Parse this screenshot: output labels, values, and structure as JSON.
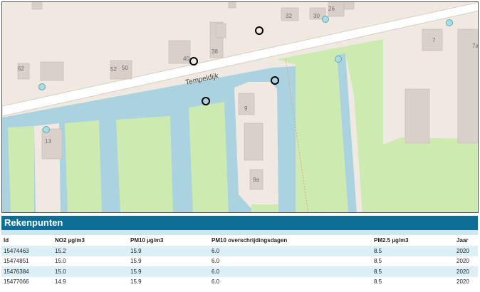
{
  "map": {
    "street_name": "Tempeldijk",
    "house_numbers": [
      "32",
      "30",
      "26",
      "40",
      "38",
      "62",
      "52",
      "50",
      "7",
      "7a",
      "9",
      "9a",
      "13"
    ],
    "colors": {
      "land": "#efe9e1",
      "water": "#aad3df",
      "grass": "#cdebb0",
      "building": "#d9d0c9",
      "road": "#ffffff",
      "marker_open": "#000000",
      "marker_cyan": "#a8dde4"
    }
  },
  "panel": {
    "title": "Rekenpunten",
    "columns": [
      "Id",
      "NO2 µg/m3",
      "PM10 µg/m3",
      "PM10 overschrijdingsdagen",
      "PM2.5 µg/m3",
      "Jaar"
    ],
    "rows": [
      [
        "15474463",
        "15.2",
        "15.9",
        "6.0",
        "8.5",
        "2020"
      ],
      [
        "15474851",
        "15.0",
        "15.9",
        "6.0",
        "8.5",
        "2020"
      ],
      [
        "15476384",
        "15.0",
        "15.9",
        "6.0",
        "8.5",
        "2020"
      ],
      [
        "15477066",
        "14.9",
        "15.9",
        "6.0",
        "8.5",
        "2020"
      ]
    ]
  }
}
